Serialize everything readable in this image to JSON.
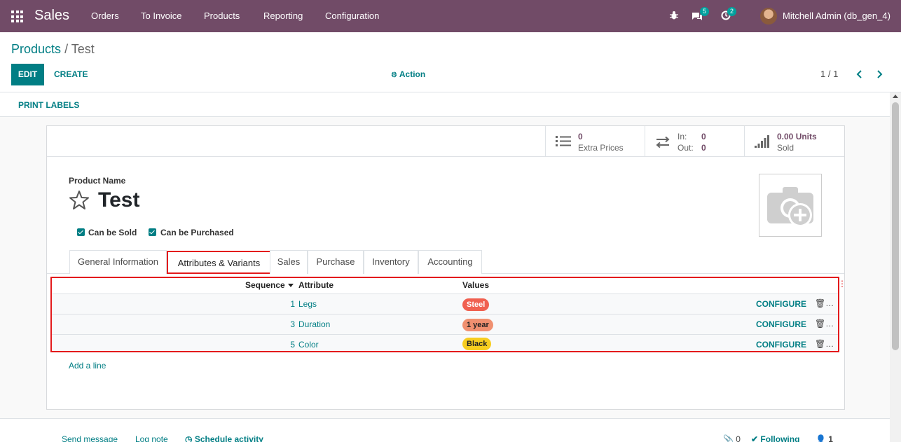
{
  "navbar": {
    "brand": "Sales",
    "menu": [
      "Orders",
      "To Invoice",
      "Products",
      "Reporting",
      "Configuration"
    ],
    "messages_count": "5",
    "activities_count": "2",
    "user": "Mitchell Admin (db_gen_4)",
    "icons": [
      "apps-grid-icon",
      "bug-icon",
      "chat-bubbles-icon",
      "clock-icon"
    ],
    "color": "#714b67"
  },
  "breadcrumb": {
    "parent": "Products",
    "separator": "/",
    "current": "Test"
  },
  "toolbar": {
    "edit": "EDIT",
    "create": "CREATE",
    "action": "Action",
    "pager": "1 / 1"
  },
  "statusbar": {
    "print_labels": "PRINT LABELS"
  },
  "smart_buttons": {
    "extra_prices": {
      "value": "0",
      "label": "Extra Prices"
    },
    "in_out": {
      "in_label": "In:",
      "in_value": "0",
      "out_label": "Out:",
      "out_value": "0"
    },
    "sold": {
      "value": "0.00 Units",
      "label": "Sold"
    }
  },
  "product": {
    "name_label": "Product Name",
    "name": "Test",
    "can_be_sold": "Can be Sold",
    "can_be_purchased": "Can be Purchased"
  },
  "tabs": [
    "General Information",
    "Attributes & Variants",
    "Sales",
    "Purchase",
    "Inventory",
    "Accounting"
  ],
  "active_tab": "Attributes & Variants",
  "attributes_table": {
    "headers": {
      "sequence": "Sequence",
      "attribute": "Attribute",
      "values": "Values"
    },
    "rows": [
      {
        "sequence": "1",
        "attribute": "Legs",
        "value": "Steel",
        "value_color": "#f06050",
        "action": "CONFIGURE"
      },
      {
        "sequence": "3",
        "attribute": "Duration",
        "value": "1 year",
        "value_color": "#f4a460",
        "action": "CONFIGURE"
      },
      {
        "sequence": "5",
        "attribute": "Color",
        "value": "Black",
        "value_color": "#f7cd1f",
        "action": "CONFIGURE"
      }
    ],
    "add_line": "Add a line"
  },
  "chatter": {
    "send_message": "Send message",
    "log_note": "Log note",
    "schedule_activity": "Schedule activity",
    "attachments": "0",
    "following": "Following",
    "followers": "1"
  },
  "accent_color": "#017e84",
  "highlight_color": "#e31a1c"
}
